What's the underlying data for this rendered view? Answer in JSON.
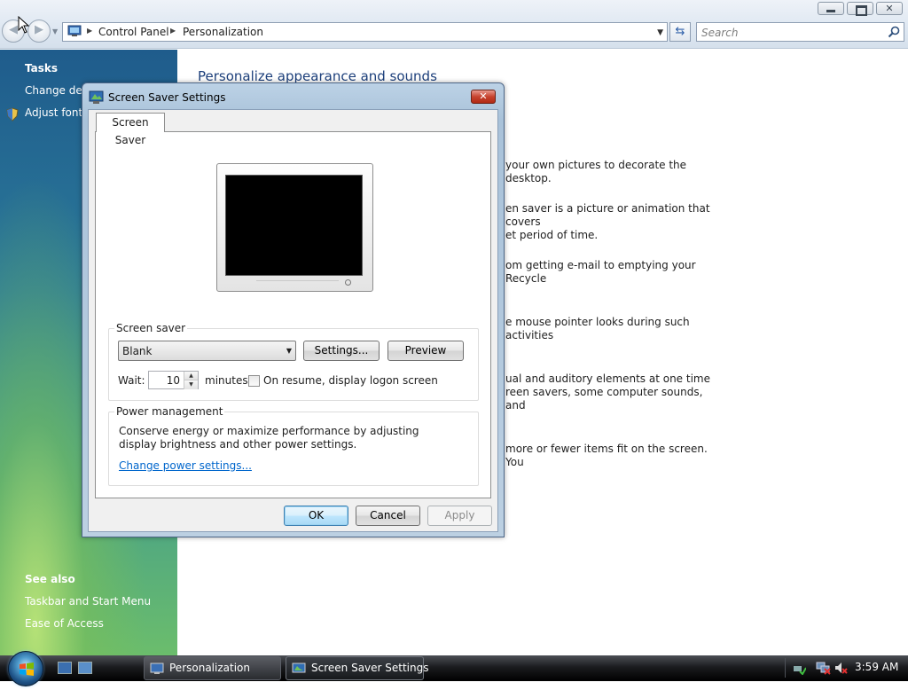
{
  "window": {
    "breadcrumb": [
      "Control Panel",
      "Personalization"
    ],
    "search_placeholder": "Search",
    "controls": {
      "close_label": "✕"
    }
  },
  "sidebar": {
    "tasks_heading": "Tasks",
    "tasks": [
      {
        "label": "Change desktop icons"
      },
      {
        "label": "Adjust font size (DPI)"
      }
    ],
    "see_also_heading": "See also",
    "see_also": [
      {
        "label": "Taskbar and Start Menu"
      },
      {
        "label": "Ease of Access"
      }
    ]
  },
  "main": {
    "title": "Personalize appearance and sounds",
    "descriptions": [
      "your own pictures to decorate the desktop.",
      "en saver is a picture or animation that covers\net period of time.",
      "om getting e-mail to emptying your Recycle",
      "e mouse pointer looks during such activities",
      "ual and auditory elements at one time\nreen savers, some computer sounds, and",
      "more or fewer items fit on the screen. You"
    ]
  },
  "dialog": {
    "title": "Screen Saver Settings",
    "close_label": "✕",
    "tab": "Screen Saver",
    "screen_saver": {
      "group_label": "Screen saver",
      "selected": "Blank",
      "settings_button": "Settings...",
      "preview_button": "Preview",
      "wait_label": "Wait:",
      "wait_value": "10",
      "minutes_label": "minutes",
      "resume_checkbox_label": "On resume, display logon screen",
      "resume_checked": false
    },
    "power": {
      "group_label": "Power management",
      "text": "Conserve energy or maximize performance by adjusting display brightness and other power settings.",
      "link": "Change power settings..."
    },
    "buttons": {
      "ok": "OK",
      "cancel": "Cancel",
      "apply": "Apply"
    }
  },
  "taskbar": {
    "items": [
      {
        "label": "Personalization",
        "active": false
      },
      {
        "label": "Screen Saver Settings",
        "active": true
      }
    ],
    "clock": "3:59 AM"
  }
}
